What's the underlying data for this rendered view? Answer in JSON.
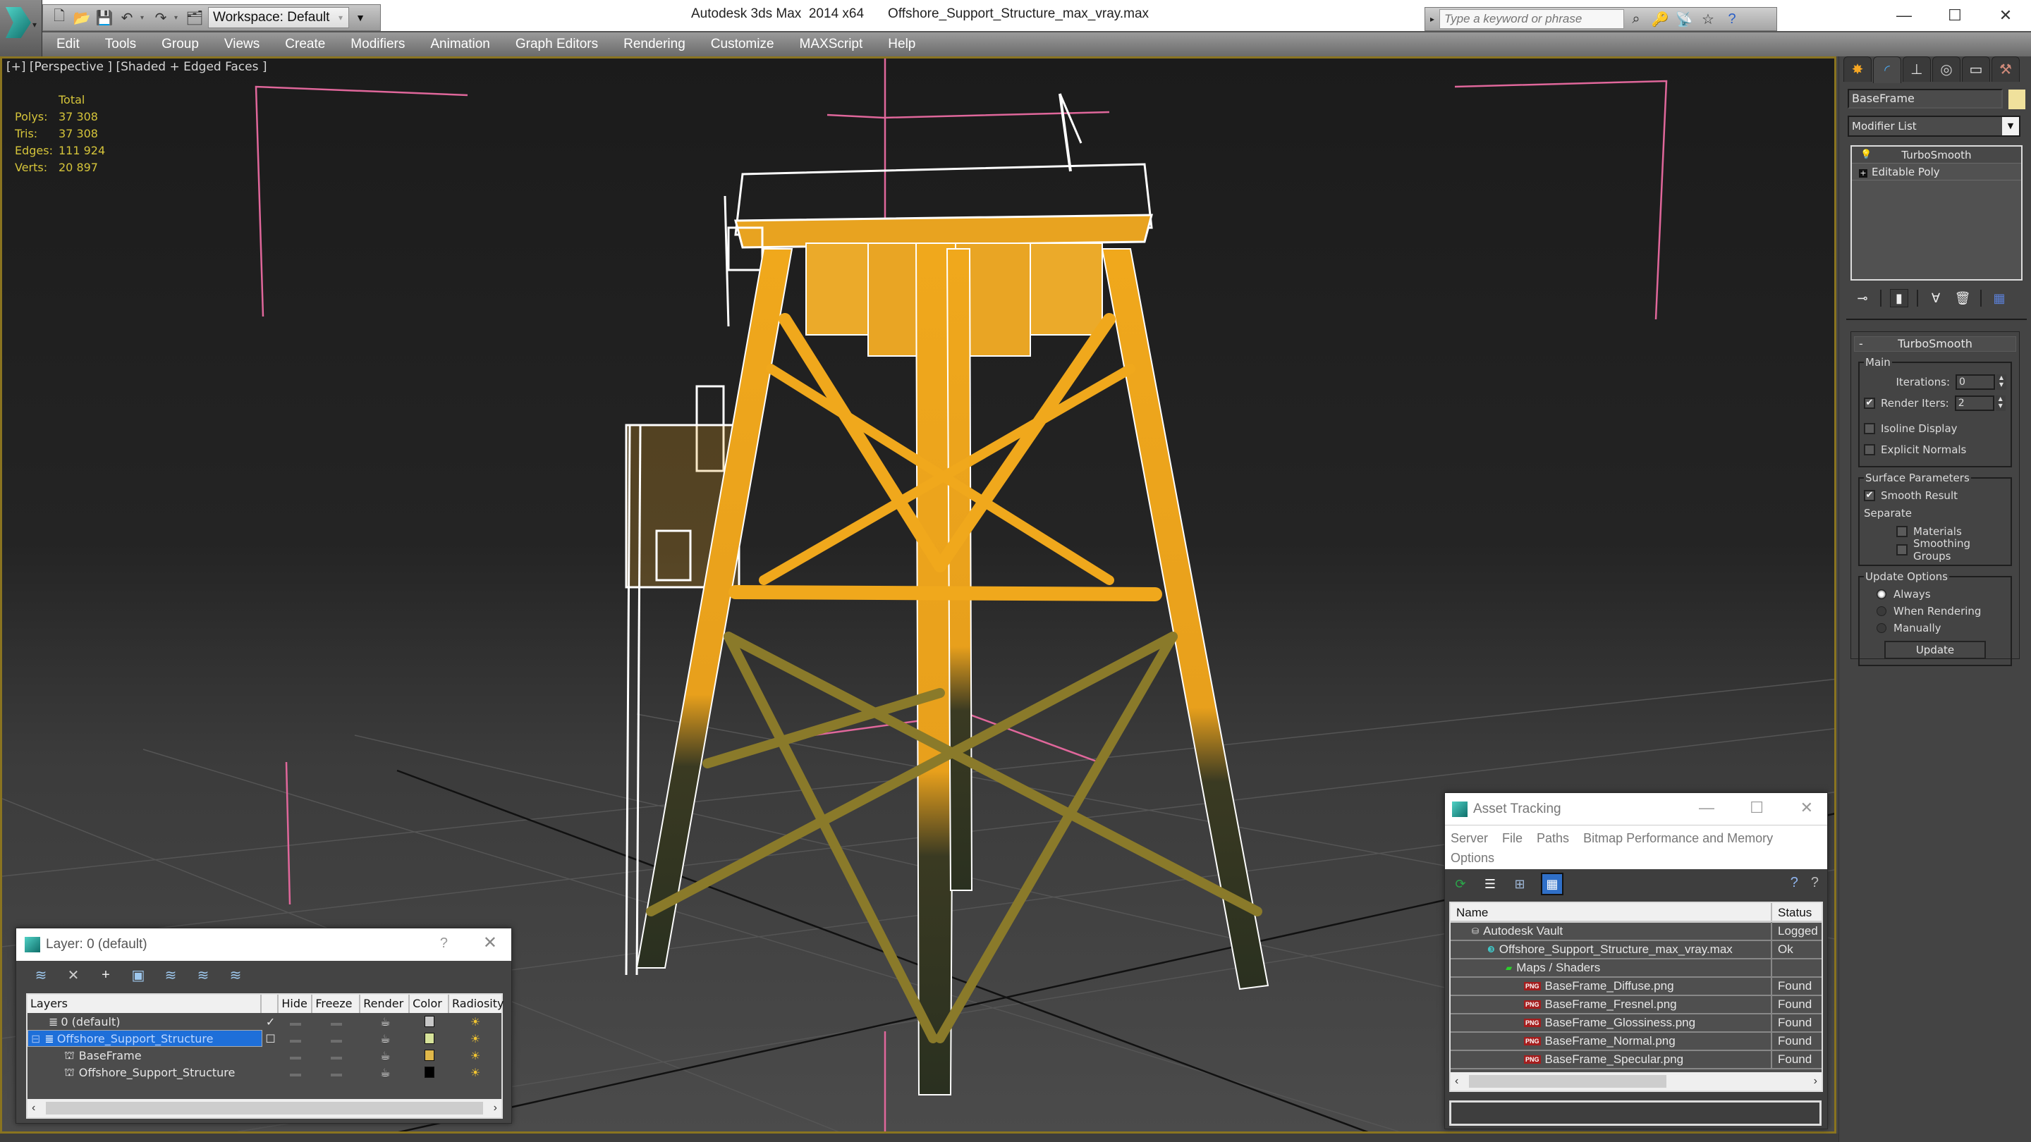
{
  "app": {
    "title": "Autodesk 3ds Max  2014 x64",
    "file": "Offshore_Support_Structure_max_vray.max"
  },
  "quick_access": {
    "icons": [
      "new-file-icon",
      "open-file-icon",
      "save-icon",
      "undo-icon",
      "redo-icon",
      "project-folder-icon"
    ],
    "workspace_label": "Workspace: Default"
  },
  "search": {
    "placeholder": "Type a keyword or phrase",
    "icons": [
      "binoculars-icon",
      "key-icon",
      "satellite-icon",
      "star-icon",
      "help-icon"
    ]
  },
  "window_controls": {
    "minimize": "—",
    "maximize": "☐",
    "close": "✕"
  },
  "menu": [
    "Edit",
    "Tools",
    "Group",
    "Views",
    "Create",
    "Modifiers",
    "Animation",
    "Graph Editors",
    "Rendering",
    "Customize",
    "MAXScript",
    "Help"
  ],
  "viewport": {
    "label": "[+] [Perspective ] [Shaded + Edged Faces ]",
    "stats": {
      "header": "Total",
      "rows": [
        {
          "key": "Polys:",
          "value": "37 308"
        },
        {
          "key": "Tris:",
          "value": "37 308"
        },
        {
          "key": "Edges:",
          "value": "111 924"
        },
        {
          "key": "Verts:",
          "value": "20 897"
        }
      ]
    },
    "model_color": "#f0a81c"
  },
  "command_panel": {
    "tabs": [
      "create-tab",
      "modify-tab",
      "hierarchy-tab",
      "motion-tab",
      "display-tab",
      "utilities-tab"
    ],
    "active_tab": 1,
    "object_name": "BaseFrame",
    "object_color": "#f0e19c",
    "modifier_list_label": "Modifier List",
    "stack": [
      {
        "label": "TurboSmooth"
      },
      {
        "label": "Editable Poly"
      }
    ],
    "rollout": {
      "title": "TurboSmooth",
      "collapse": "-",
      "main": {
        "legend": "Main",
        "iterations_label": "Iterations:",
        "iterations": "0",
        "render_iters_label": "Render Iters:",
        "render_iters": "2",
        "render_iters_checked": true,
        "isoline_label": "Isoline Display",
        "isoline_checked": false,
        "explicit_normals_label": "Explicit Normals",
        "explicit_normals_checked": false
      },
      "surface": {
        "legend": "Surface Parameters",
        "smooth_result_label": "Smooth Result",
        "smooth_result_checked": true,
        "separate_label": "Separate",
        "materials_label": "Materials",
        "smoothing_groups_label": "Smoothing Groups"
      },
      "update": {
        "legend": "Update Options",
        "options": [
          "Always",
          "When Rendering",
          "Manually"
        ],
        "selected": "Always",
        "button": "Update"
      }
    }
  },
  "layer_dialog": {
    "title": "Layer: 0 (default)",
    "help": "?",
    "close": "✕",
    "toolbar": [
      "create-layer-icon",
      "delete-layer-icon",
      "add-to-layer-icon",
      "select-objects-icon",
      "select-layer-icon",
      "highlight-layer-icon",
      "hide-freeze-all-icon"
    ],
    "columns": [
      "Layers",
      "",
      "Hide",
      "Freeze",
      "Render",
      "Color",
      "Radiosity"
    ],
    "rows": [
      {
        "name": "0 (default)",
        "type": "layer",
        "active": "✓",
        "color": "#c8c8c8",
        "indent": 0,
        "selected": false
      },
      {
        "name": "Offshore_Support_Structure",
        "type": "layer",
        "active": "☐",
        "color": "#d7e39a",
        "indent": 0,
        "selected": true,
        "expander": "⊟"
      },
      {
        "name": "BaseFrame",
        "type": "object",
        "active": "",
        "color": "#e0b84a",
        "indent": 1,
        "selected": false
      },
      {
        "name": "Offshore_Support_Structure",
        "type": "object",
        "active": "",
        "color": "#000000",
        "indent": 1,
        "selected": false
      }
    ],
    "scroll_left": "‹",
    "scroll_right": "›"
  },
  "asset_dialog": {
    "title": "Asset Tracking",
    "menu": [
      "Server",
      "File",
      "Paths",
      "Bitmap Performance and Memory",
      "Options"
    ],
    "toolbar": [
      "refresh-icon",
      "list-view-icon",
      "tree-view-icon",
      "table-view-icon"
    ],
    "columns": [
      "Name",
      "Status"
    ],
    "rows": [
      {
        "name": "Autodesk Vault",
        "status": "Logged Out",
        "icon": "vault-icon",
        "indent": 1
      },
      {
        "name": "Offshore_Support_Structure_max_vray.max",
        "status": "Ok",
        "icon": "max-file-icon",
        "indent": 2
      },
      {
        "name": "Maps / Shaders",
        "status": "",
        "icon": "maps-icon",
        "indent": 3
      },
      {
        "name": "BaseFrame_Diffuse.png",
        "status": "Found",
        "icon": "png-icon",
        "indent": 4
      },
      {
        "name": "BaseFrame_Fresnel.png",
        "status": "Found",
        "icon": "png-icon",
        "indent": 4
      },
      {
        "name": "BaseFrame_Glossiness.png",
        "status": "Found",
        "icon": "png-icon",
        "indent": 4
      },
      {
        "name": "BaseFrame_Normal.png",
        "status": "Found",
        "icon": "png-icon",
        "indent": 4
      },
      {
        "name": "BaseFrame_Specular.png",
        "status": "Found",
        "icon": "png-icon",
        "indent": 4
      }
    ],
    "scroll_left": "‹",
    "scroll_right": "›"
  }
}
